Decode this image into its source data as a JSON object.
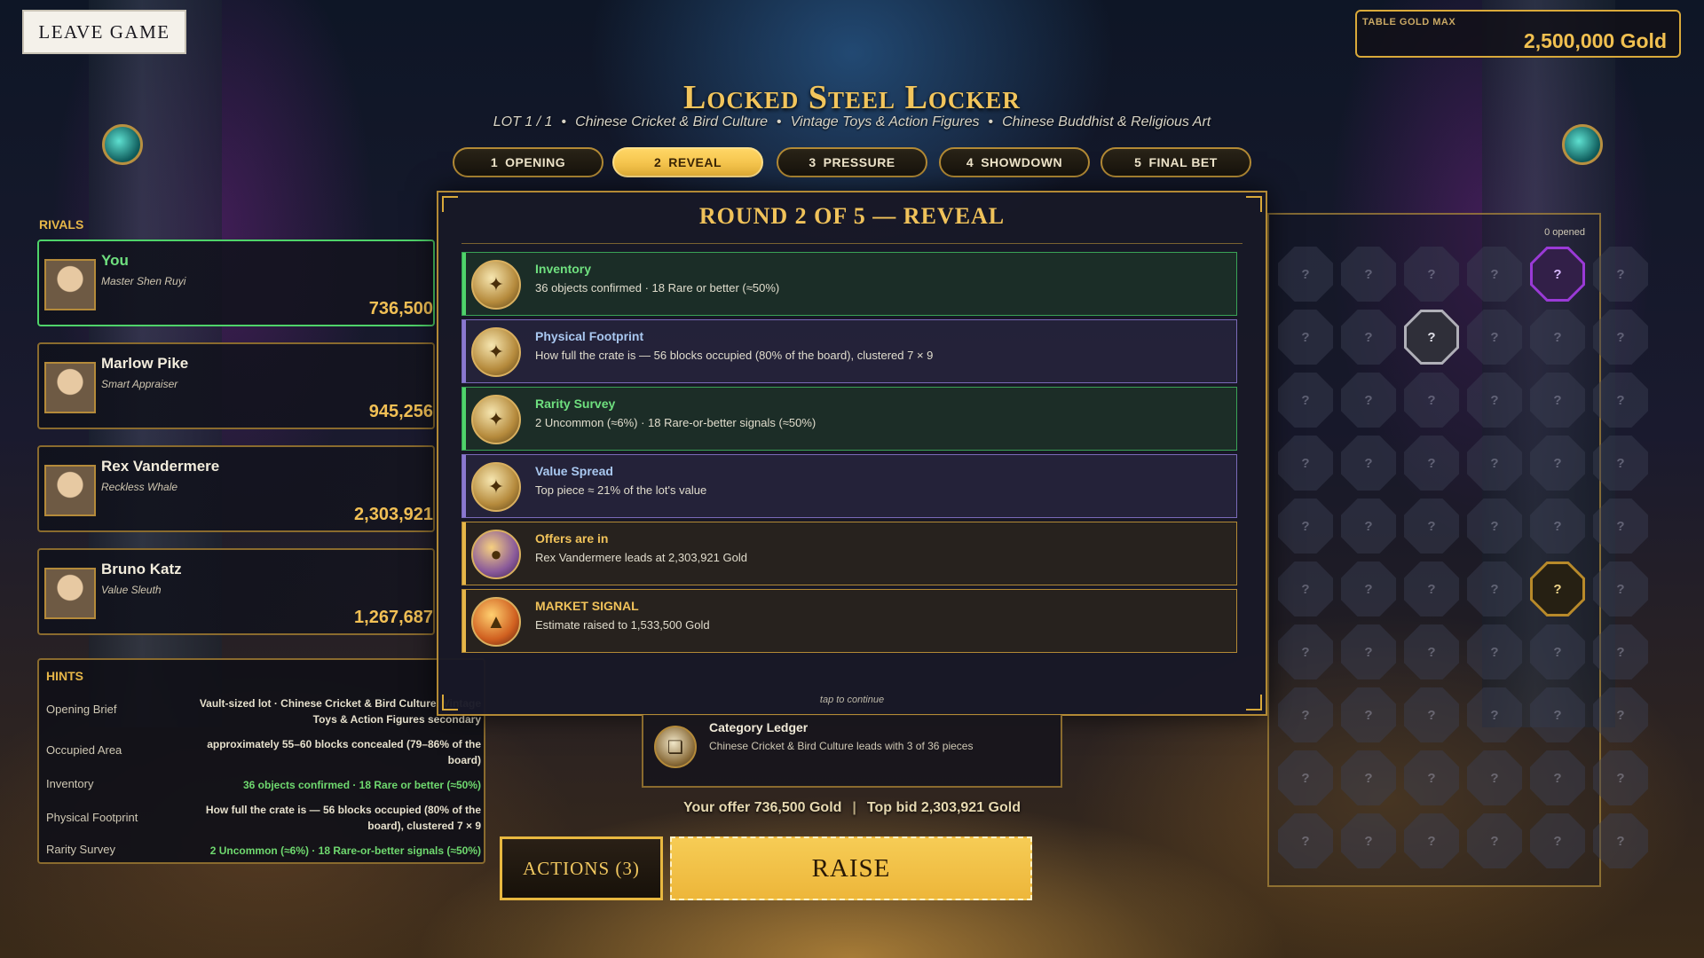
{
  "header": {
    "leave_label": "LEAVE GAME",
    "gold_max_label": "TABLE GOLD MAX",
    "gold_max_value": "2,500,000 Gold",
    "title": "Locked Steel Locker",
    "lot": "LOT 1 / 1",
    "categories": [
      "Chinese Cricket & Bird Culture",
      "Vintage Toys & Action Figures",
      "Chinese Buddhist & Religious Art"
    ]
  },
  "phases": [
    {
      "num": "1",
      "label": "OPENING",
      "active": false
    },
    {
      "num": "2",
      "label": "REVEAL",
      "active": true
    },
    {
      "num": "3",
      "label": "PRESSURE",
      "active": false
    },
    {
      "num": "4",
      "label": "SHOWDOWN",
      "active": false
    },
    {
      "num": "5",
      "label": "FINAL BET",
      "active": false
    }
  ],
  "rivals": {
    "title": "RIVALS",
    "list": [
      {
        "name": "You",
        "role": "Master Shen Ruyi",
        "gold": "736,500"
      },
      {
        "name": "Marlow Pike",
        "role": "Smart Appraiser",
        "gold": "945,256"
      },
      {
        "name": "Rex Vandermere",
        "role": "Reckless Whale",
        "gold": "2,303,921"
      },
      {
        "name": "Bruno Katz",
        "role": "Value Sleuth",
        "gold": "1,267,687"
      }
    ]
  },
  "hints": {
    "title": "HINTS",
    "rows": [
      {
        "key": "Opening Brief",
        "value": "Vault-sized lot · Chinese Cricket & Bird Culture; Vintage Toys & Action Figures secondary"
      },
      {
        "key": "Occupied Area",
        "value": "approximately 55–60 blocks concealed (79–86% of the board)"
      },
      {
        "key": "Inventory",
        "value": "36 objects confirmed · 18 Rare or better (≈50%)"
      },
      {
        "key": "Physical Footprint",
        "value": "How full the crate is — 56 blocks occupied (80% of the board), clustered 7 × 9"
      },
      {
        "key": "Rarity Survey",
        "value": "2 Uncommon (≈6%) · 18 Rare-or-better signals (≈50%)"
      }
    ]
  },
  "modal": {
    "title": "ROUND 2 OF 5 — REVEAL",
    "cards": [
      {
        "title": "Inventory",
        "desc": "36 objects confirmed · 18 Rare or better (≈50%)",
        "icon": "scroll-icon"
      },
      {
        "title": "Physical Footprint",
        "desc": "How full the crate is — 56 blocks occupied (80% of the board), clustered 7 × 9",
        "icon": "scroll-icon"
      },
      {
        "title": "Rarity Survey",
        "desc": "2 Uncommon (≈6%) · 18 Rare-or-better signals (≈50%)",
        "icon": "scroll-icon"
      },
      {
        "title": "Value Spread",
        "desc": "Top piece ≈ 21% of the lot's value",
        "icon": "scroll-icon"
      },
      {
        "title": "Offers are in",
        "desc": "Rex Vandermere leads at 2,303,921 Gold",
        "icon": "coins-icon"
      },
      {
        "title": "MARKET SIGNAL",
        "desc": "Estimate raised to 1,533,500 Gold",
        "icon": "flame-icon"
      }
    ],
    "tap": "tap to continue"
  },
  "board": {
    "opened": "0 opened",
    "unknown_mark": "?"
  },
  "ledger": {
    "title": "Category Ledger",
    "desc": "Chinese Cricket & Bird Culture leads with 3 of 36 pieces"
  },
  "offer": {
    "yours": "Your offer 736,500 Gold",
    "top": "Top bid 2,303,921 Gold"
  },
  "buttons": {
    "actions": "ACTIONS (3)",
    "raise": "RAISE"
  },
  "colors": {
    "accent_gold": "#f0c25a",
    "you_green": "#4fd36a",
    "raise_yellow": "#f6cc55"
  }
}
